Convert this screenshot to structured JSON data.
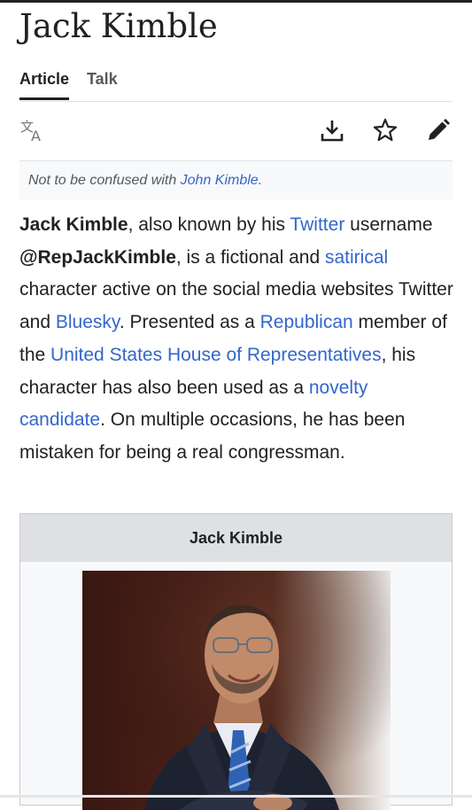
{
  "page": {
    "title": "Jack Kimble",
    "tabs": [
      {
        "label": "Article",
        "active": true
      },
      {
        "label": "Talk",
        "active": false
      }
    ],
    "toolbar": {
      "icons": [
        "language-icon",
        "download-icon",
        "star-icon",
        "edit-icon"
      ]
    }
  },
  "hatnote": {
    "prefix": "Not to be confused with ",
    "link": "John Kimble",
    "suffix": "."
  },
  "intro": {
    "parts": [
      {
        "text": "Jack Kimble",
        "style": "bold"
      },
      {
        "text": ", also known by his ",
        "style": "plain"
      },
      {
        "text": "Twitter",
        "style": "link"
      },
      {
        "text": " username ",
        "style": "plain"
      },
      {
        "text": "@RepJackKimble",
        "style": "bold"
      },
      {
        "text": ", is a fictional and ",
        "style": "plain"
      },
      {
        "text": "satirical",
        "style": "link"
      },
      {
        "text": " character active on the social media websites Twitter and ",
        "style": "plain"
      },
      {
        "text": "Bluesky",
        "style": "link"
      },
      {
        "text": ". Presented as a ",
        "style": "plain"
      },
      {
        "text": "Republican",
        "style": "link"
      },
      {
        "text": " member of the ",
        "style": "plain"
      },
      {
        "text": "United States House of Representatives",
        "style": "link"
      },
      {
        "text": ", his character has also been used as a ",
        "style": "plain"
      },
      {
        "text": "novelty candidate",
        "style": "link"
      },
      {
        "text": ". On multiple occasions, he has been mistaken for being a real congressman.",
        "style": "plain"
      }
    ]
  },
  "infobox": {
    "title": "Jack Kimble"
  },
  "colors": {
    "link": "#3366cc",
    "text": "#202122",
    "muted": "#54595d",
    "infobox_header": "#dfe0e4"
  }
}
